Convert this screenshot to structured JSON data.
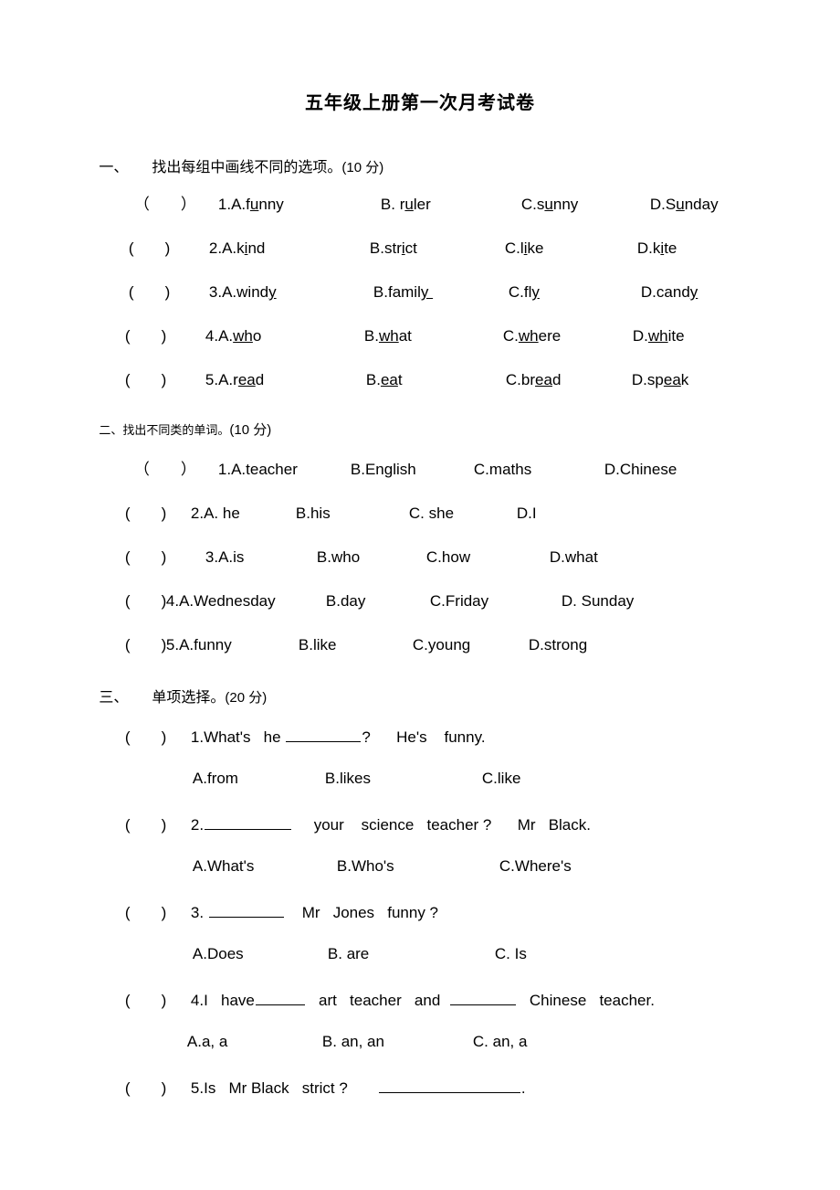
{
  "document": {
    "title": "五年级上册第一次月考试卷",
    "background_color": "#ffffff",
    "text_color": "#000000"
  },
  "sections": [
    {
      "id": "section-1",
      "number": "一、",
      "instruction_cn": "找出每组中画线不同的选项。",
      "marks": "(10 分)",
      "heading_text": "一、　找出每组中画线不同的选项。(10 分)",
      "items": [
        {
          "bracket": "（　　）",
          "number": "1.",
          "options": [
            {
              "label": "A.",
              "pre": "f",
              "underlined": "u",
              "post": "nny",
              "text": "A.funny"
            },
            {
              "label": "B. ",
              "pre": "r",
              "underlined": "u",
              "post": "ler",
              "text": "B. ruler"
            },
            {
              "label": "C.",
              "pre": "s",
              "underlined": "u",
              "post": "nny",
              "text": "C.sunny"
            },
            {
              "label": "D.",
              "pre": "S",
              "underlined": "u",
              "post": "nday",
              "text": "D.Sunday"
            }
          ]
        },
        {
          "bracket": "(　　)",
          "number": "2.",
          "options": [
            {
              "label": "A.",
              "pre": "k",
              "underlined": "i",
              "post": "nd",
              "text": "A.kind"
            },
            {
              "label": "B.",
              "pre": "str",
              "underlined": "i",
              "post": "ct",
              "text": "B.strict"
            },
            {
              "label": "C.",
              "pre": "l",
              "underlined": "i",
              "post": "ke",
              "text": "C.like"
            },
            {
              "label": "D.",
              "pre": "k",
              "underlined": "i",
              "post": "te",
              "text": "D.kite"
            }
          ]
        },
        {
          "bracket": "(　　)",
          "number": "3.",
          "options": [
            {
              "label": "A.",
              "pre": "wind",
              "underlined": "y",
              "post": "",
              "text": "A.windy"
            },
            {
              "label": "B.",
              "pre": "famil",
              "underlined": "y ",
              "post": "",
              "text": "B.family"
            },
            {
              "label": "C.",
              "pre": "fl",
              "underlined": "y",
              "post": "",
              "text": "C.fly"
            },
            {
              "label": "D.",
              "pre": "cand",
              "underlined": "y",
              "post": "",
              "text": "D.candy"
            }
          ]
        },
        {
          "bracket": "(　　)",
          "number": "4.",
          "options": [
            {
              "label": "A.",
              "pre": "",
              "underlined": "wh",
              "post": "o",
              "text": "A.who"
            },
            {
              "label": "B.",
              "pre": "",
              "underlined": "wh",
              "post": "at",
              "text": "B.what"
            },
            {
              "label": "C.",
              "pre": "",
              "underlined": "wh",
              "post": "ere",
              "text": "C.where"
            },
            {
              "label": "D.",
              "pre": "",
              "underlined": "wh",
              "post": "ite",
              "text": "D.white"
            }
          ]
        },
        {
          "bracket": "(　　)",
          "number": "5.",
          "options": [
            {
              "label": "A.",
              "pre": "r",
              "underlined": "ea",
              "post": "d",
              "text": "A.read"
            },
            {
              "label": "B.",
              "pre": "",
              "underlined": "ea",
              "post": "t",
              "text": "B.eat"
            },
            {
              "label": "C.",
              "pre": "br",
              "underlined": "ea",
              "post": "d",
              "text": "C.bread"
            },
            {
              "label": "D.",
              "pre": "sp",
              "underlined": "ea",
              "post": "k",
              "text": "D.speak"
            }
          ]
        }
      ]
    },
    {
      "id": "section-2",
      "number": "二、",
      "instruction_cn": "找出不同类的单词。",
      "marks": "(10 分)",
      "heading_text": "二、找出不同类的单词。(10 分)",
      "items": [
        {
          "bracket": "（　　）",
          "number": "1.",
          "options": [
            "A.teacher",
            "B.English",
            "C.maths",
            "D.Chinese"
          ]
        },
        {
          "bracket": "(　　)",
          "number": "2.",
          "options": [
            "A. he",
            "B.his",
            "C. she",
            "D.I"
          ]
        },
        {
          "bracket": "(　　)",
          "number": "3.",
          "options": [
            "A.is",
            "B.who",
            "C.how",
            "D.what"
          ]
        },
        {
          "bracket": "(　　)",
          "number": "4.",
          "options": [
            "A.Wednesday",
            "B.day",
            "C.Friday",
            "D. Sunday"
          ]
        },
        {
          "bracket": "(　　)",
          "number": "5.",
          "options": [
            "A.funny",
            "B.like",
            "C.young",
            "D.strong"
          ]
        }
      ]
    },
    {
      "id": "section-3",
      "number": "三、",
      "instruction_cn": "单项选择。",
      "marks": "(20 分)",
      "heading_text": "三、　单项选择。(20 分)",
      "items": [
        {
          "bracket": "(　　)",
          "number": "1.",
          "stem_part1": "What's   he ",
          "blank_width": 82,
          "stem_part2": "?      He's    funny.",
          "stem_text": "1.What's   he ________?      He's    funny.",
          "choices": [
            "A.from",
            "B.likes",
            "C.like"
          ]
        },
        {
          "bracket": "(　　)",
          "number": "2.",
          "stem_part1": "",
          "blank_width": 95,
          "stem_part2": "     your    science   teacher ?      Mr   Black.",
          "stem_text": "2.__________     your    science   teacher ?      Mr   Black.",
          "choices": [
            "A.What's",
            "B.Who's",
            "C.Where's"
          ]
        },
        {
          "bracket": "(　　)",
          "number": "3. ",
          "stem_part1": "",
          "blank_width": 82,
          "stem_part2": "    Mr   Jones   funny ?",
          "stem_text": "3. ________    Mr   Jones   funny ?",
          "choices": [
            "A.Does",
            "B. are",
            "C. Is"
          ]
        },
        {
          "bracket": "(　　)",
          "number": "4.",
          "stem_part1": "I   have",
          "blank_width": 54,
          "stem_part2": "   art   teacher   and  ",
          "blank2_width": 72,
          "stem_part3": "   Chinese   teacher.",
          "stem_text": "4.I   have_____   art   teacher   and   ________   Chinese   teacher.",
          "choices": [
            "A.a, a",
            "B. an, an",
            "C. an, a"
          ]
        },
        {
          "bracket": "(　　)",
          "number": "5.",
          "stem_part1": "Is   Mr Black   strict ?       ",
          "blank_width": 155,
          "stem_part2": ".",
          "stem_text": "5.Is   Mr Black   strict ?       ______________.",
          "choices": []
        }
      ]
    }
  ]
}
